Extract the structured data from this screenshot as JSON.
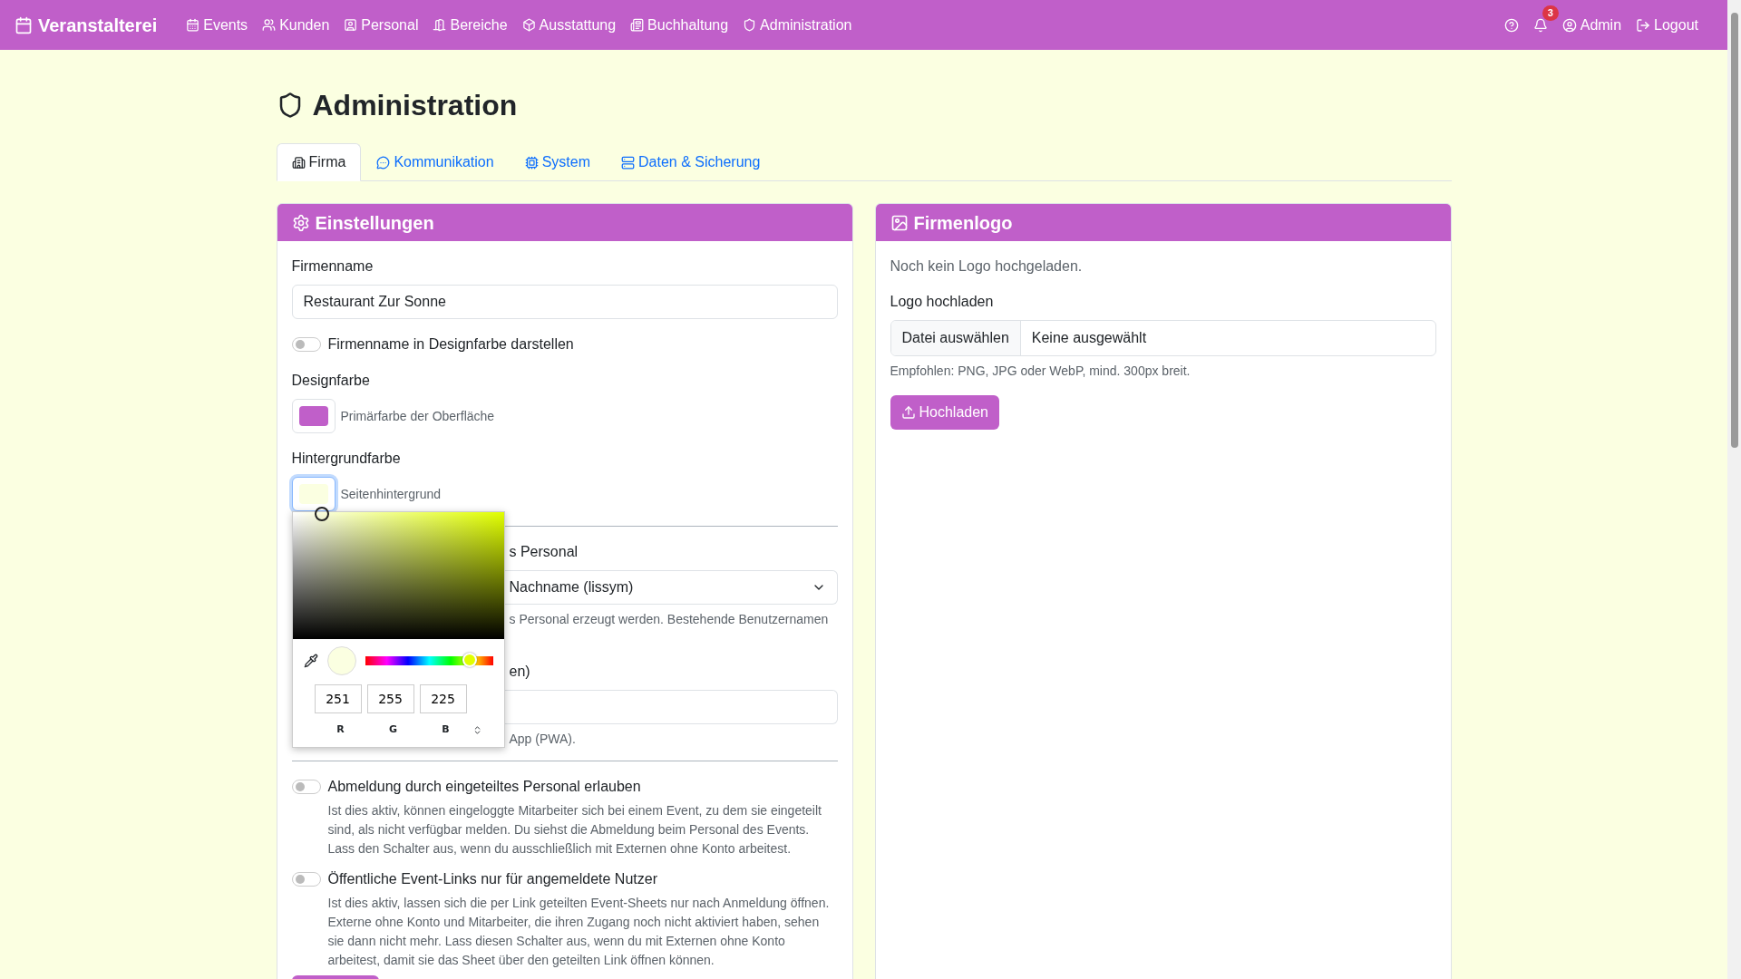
{
  "navbar": {
    "brand": "Veranstalterei",
    "items": [
      {
        "label": "Events"
      },
      {
        "label": "Kunden"
      },
      {
        "label": "Personal"
      },
      {
        "label": "Bereiche"
      },
      {
        "label": "Ausstattung"
      },
      {
        "label": "Buchhaltung"
      },
      {
        "label": "Administration"
      }
    ],
    "notification_count": "3",
    "user": "Admin",
    "logout": "Logout"
  },
  "page": {
    "title": "Administration"
  },
  "tabs": [
    {
      "label": "Firma",
      "selected": true
    },
    {
      "label": "Kommunikation",
      "selected": false
    },
    {
      "label": "System",
      "selected": false
    },
    {
      "label": "Daten & Sicherung",
      "selected": false
    }
  ],
  "settings_card": {
    "title": "Einstellungen",
    "company_name": {
      "label": "Firmenname",
      "value": "Restaurant Zur Sonne"
    },
    "brand_toggle": {
      "label": "Firmenname in Designfarbe darstellen",
      "on": false
    },
    "color_fields": [
      {
        "label": "Designfarbe",
        "hint": "Primärfarbe der Oberfläche",
        "color": "#c05fc9",
        "focused": false
      },
      {
        "label": "Hintergrundfarbe",
        "hint": "Seitenhintergrund",
        "color": "#fbffe1",
        "focused": true
      }
    ],
    "color_picker": {
      "r": "251",
      "g": "255",
      "b": "225",
      "channel_labels": [
        "R",
        "G",
        "B"
      ],
      "hue_slider": {
        "level": 0.82
      }
    },
    "covered_select": {
      "label": "s Personal",
      "value": "Nachname (lissym)",
      "help": "s Personal erzeugt werden. Bestehende Benutzernamen"
    },
    "covered_field": {
      "label": "en)",
      "help": "App (PWA)."
    },
    "toggles": [
      {
        "label": "Abmeldung durch eingeteiltes Personal erlauben",
        "description": "Ist dies aktiv, können eingeloggte Mitarbeiter sich bei einem Event, zu dem sie eingeteilt sind, als nicht verfügbar melden. Du siehst die Abmeldung beim Personal des Events. Lass den Schalter aus, wenn du ausschließlich mit Externen ohne Konto arbeitest.",
        "on": false
      },
      {
        "label": "Öffentliche Event-Links nur für angemeldete Nutzer",
        "description": "Ist dies aktiv, lassen sich die per Link geteilten Event-Sheets nur nach Anmeldung öffnen. Externe ohne Konto und Mitarbeiter, die ihren Zugang noch nicht aktiviert haben, sehen sie dann nicht mehr. Lass diesen Schalter aus, wenn du mit Externen ohne Konto arbeitest, damit sie das Sheet über den geteilten Link öffnen können.",
        "on": false
      }
    ]
  },
  "logo_card": {
    "title": "Firmenlogo",
    "status": "Noch kein Logo hochgeladen.",
    "upload_label": "Logo hochladen",
    "file_button": "Datei auswählen",
    "file_name": "Keine ausgewählt",
    "help": "Empfohlen: PNG, JPG oder WebP, mind. 300px breit.",
    "upload_button": "Hochladen"
  }
}
